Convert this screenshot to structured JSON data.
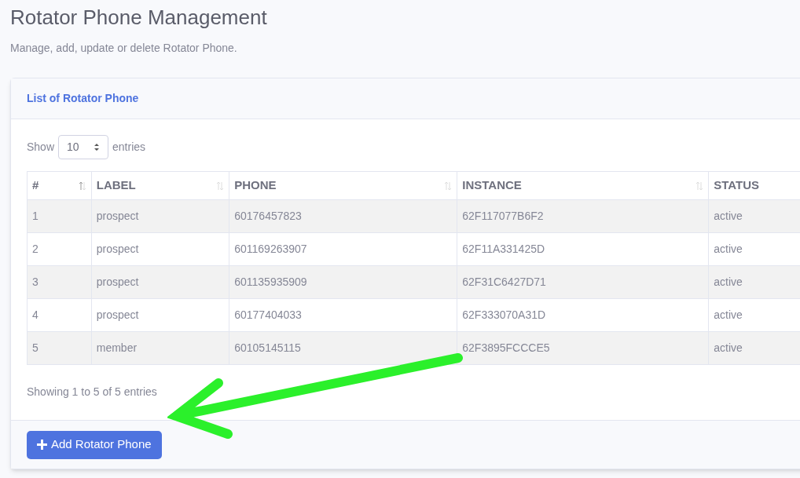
{
  "page": {
    "title": "Rotator Phone Management",
    "subtitle": "Manage, add, update or delete Rotator Phone."
  },
  "card": {
    "title": "List of Rotator Phone"
  },
  "length_control": {
    "prefix": "Show",
    "value": "10",
    "suffix": "entries"
  },
  "table": {
    "columns": [
      "#",
      "LABEL",
      "PHONE",
      "INSTANCE",
      "STATUS"
    ],
    "rows": [
      [
        "1",
        "prospect",
        "60176457823",
        "62F117077B6F2",
        "active"
      ],
      [
        "2",
        "prospect",
        "601169263907",
        "62F11A331425D",
        "active"
      ],
      [
        "3",
        "prospect",
        "601135935909",
        "62F31C6427D71",
        "active"
      ],
      [
        "4",
        "prospect",
        "60177404033",
        "62F333070A31D",
        "active"
      ],
      [
        "5",
        "member",
        "60105145115",
        "62F3895FCCCE5",
        "active"
      ]
    ]
  },
  "info": "Showing 1 to 5 of 5 entries",
  "add_button": {
    "label": "Add Rotator Phone"
  }
}
